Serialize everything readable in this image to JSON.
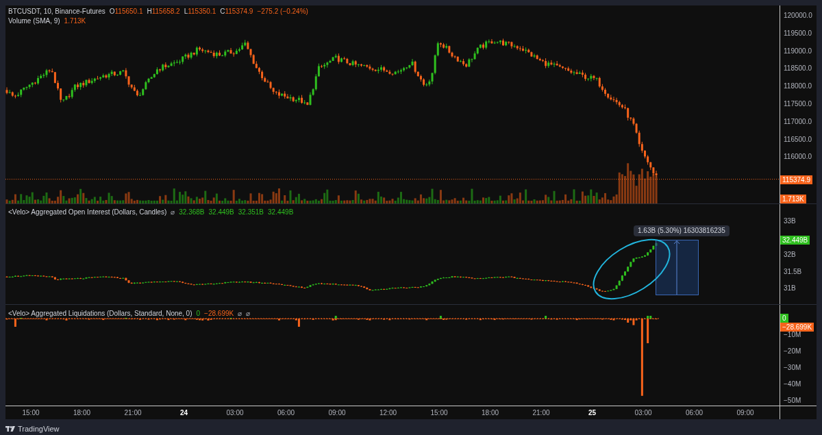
{
  "main_legend": {
    "symbol": "BTCUSDT, 10, Binance-Futures",
    "ohlc": [
      {
        "label": "O",
        "value": "115650.1"
      },
      {
        "label": "H",
        "value": "115658.2"
      },
      {
        "label": "L",
        "value": "115350.1"
      },
      {
        "label": "C",
        "value": "115374.9"
      }
    ],
    "change": "−275.2 (−0.24%)"
  },
  "volume_legend": {
    "label": "Volume (SMA, 9)",
    "value": "1.713K"
  },
  "price_axis": {
    "ticks": [
      "120000.0",
      "119500.0",
      "119000.0",
      "118500.0",
      "118000.0",
      "117500.0",
      "117000.0",
      "116500.0",
      "116000.0"
    ],
    "badges": [
      {
        "text": "115374.9",
        "color": "#f7631b"
      },
      {
        "text": "1.713K",
        "color": "#f7631b"
      }
    ]
  },
  "open_interest": {
    "legend": "<Velo> Aggregated Open Interest (Dollars, Candles)",
    "icons": [
      "⌀"
    ],
    "values": [
      "32.368B",
      "32.449B",
      "32.351B",
      "32.449B"
    ],
    "measure_label": "1.63B (5.30%) 16303816235",
    "axis": {
      "ticks": [
        "33B",
        "32B",
        "31.5B",
        "31B"
      ],
      "badges": [
        {
          "text": "32.449B",
          "color": "#2fbf1f"
        }
      ]
    }
  },
  "liquidations": {
    "legend": "<Velo> Aggregated Liquidations (Dollars, Standard, None, 0)",
    "values": [
      "0",
      "−28.699K"
    ],
    "icons": [
      "⌀",
      "⌀"
    ],
    "axis": {
      "ticks": [
        "−10M",
        "−20M",
        "−30M",
        "−40M",
        "−50M"
      ],
      "badges": [
        {
          "text": "0",
          "color": "#2fbf1f"
        },
        {
          "text": "−28.699K",
          "color": "#f7631b"
        }
      ]
    }
  },
  "time_axis": [
    {
      "label": "15:00",
      "kind": "time"
    },
    {
      "label": "18:00",
      "kind": "time"
    },
    {
      "label": "21:00",
      "kind": "time"
    },
    {
      "label": "24",
      "kind": "day"
    },
    {
      "label": "03:00",
      "kind": "time"
    },
    {
      "label": "06:00",
      "kind": "time"
    },
    {
      "label": "09:00",
      "kind": "time"
    },
    {
      "label": "12:00",
      "kind": "time"
    },
    {
      "label": "15:00",
      "kind": "time"
    },
    {
      "label": "18:00",
      "kind": "time"
    },
    {
      "label": "21:00",
      "kind": "time"
    },
    {
      "label": "25",
      "kind": "day"
    },
    {
      "label": "03:00",
      "kind": "time"
    },
    {
      "label": "06:00",
      "kind": "time"
    },
    {
      "label": "09:00",
      "kind": "time"
    }
  ],
  "footer": {
    "brand": "TradingView"
  }
}
